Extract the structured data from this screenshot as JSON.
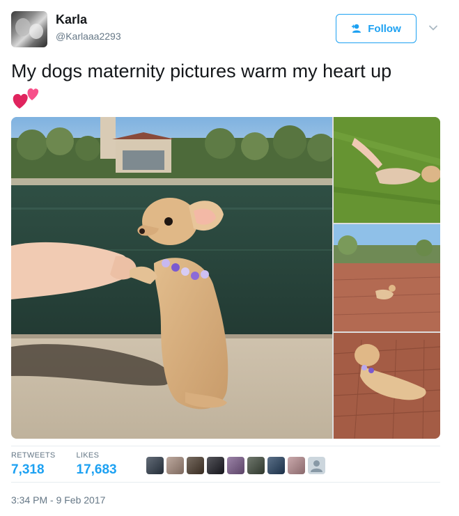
{
  "user": {
    "name": "Karla",
    "handle": "@Karlaaa2293"
  },
  "follow_button": {
    "label": "Follow",
    "icon": "add-user-icon"
  },
  "caret_icon": "chevron-down-icon",
  "tweet": {
    "text": "My dogs maternity pictures warm my heart up",
    "emoji": "two-hearts-icon"
  },
  "media": {
    "photos": [
      "chihuahua-sitting-by-pond",
      "chihuahua-on-grass",
      "chihuahua-on-brick-plaza",
      "chihuahua-lying-on-bricks"
    ]
  },
  "stats": {
    "retweets_label": "RETWEETS",
    "retweets_value": "7,318",
    "likes_label": "LIKES",
    "likes_value": "17,683"
  },
  "likers": {
    "colors": [
      "#2f3b4a",
      "#a78c7e",
      "#4a3a2c",
      "#1c1c24",
      "#7a5a8a",
      "#3f4a3c",
      "#244060",
      "#b88c90",
      "#ccd6dd"
    ]
  },
  "timestamp": "3:34 PM - 9 Feb 2017",
  "colors": {
    "accent": "#1da1f2",
    "text": "#14171a",
    "muted": "#657786",
    "heart": "#e0245e"
  }
}
